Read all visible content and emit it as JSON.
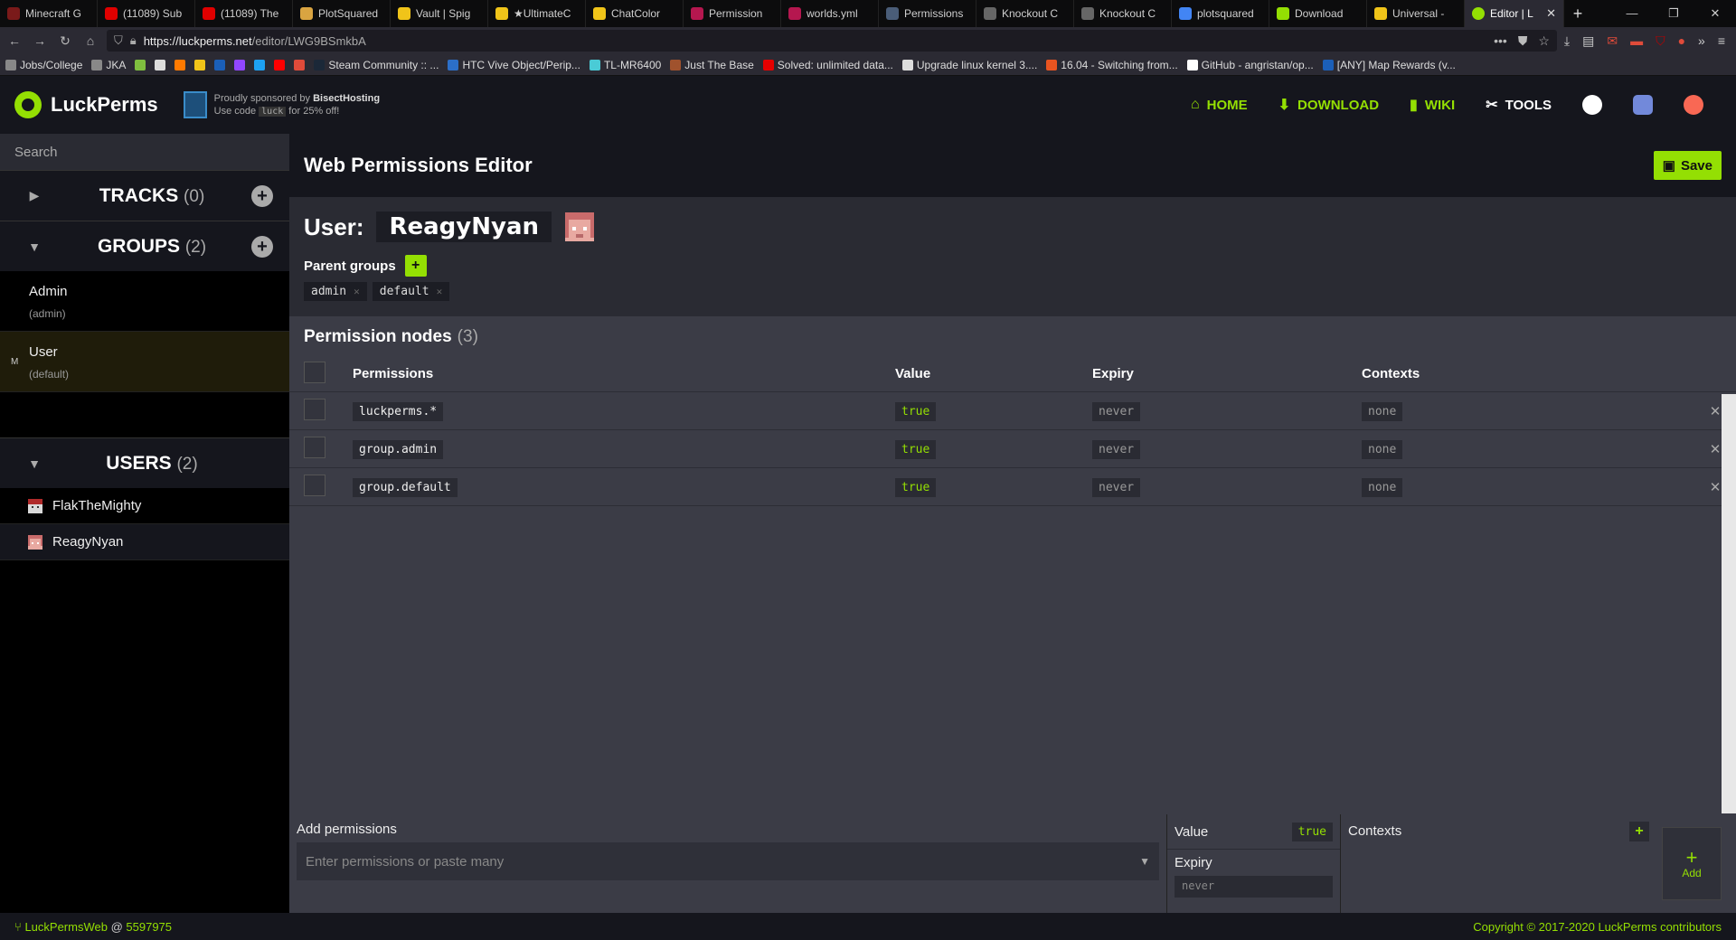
{
  "browser": {
    "tabs": [
      {
        "label": "Minecraft G",
        "color": "#7a1a1a"
      },
      {
        "label": "(11089) Sub",
        "color": "#e00000"
      },
      {
        "label": "(11089) The",
        "color": "#e00000"
      },
      {
        "label": "PlotSquared",
        "color": "#d9a441"
      },
      {
        "label": "Vault | Spig",
        "color": "#f0c419"
      },
      {
        "label": "★UltimateC",
        "color": "#f0c419"
      },
      {
        "label": "ChatColor",
        "color": "#f0c419"
      },
      {
        "label": "Permission",
        "color": "#b5174f"
      },
      {
        "label": "worlds.yml",
        "color": "#b5174f"
      },
      {
        "label": "Permissions",
        "color": "#4a5d78"
      },
      {
        "label": "Knockout C",
        "color": "#666666"
      },
      {
        "label": "Knockout C",
        "color": "#666666"
      },
      {
        "label": "plotsquared",
        "color": "#4285f4"
      },
      {
        "label": "Download",
        "color": "#94df03"
      },
      {
        "label": "Universal -",
        "color": "#f0c419"
      }
    ],
    "active_tab": "Editor | L",
    "url_host": "https://luckperms.net",
    "url_path": "/editor/LWG9BSmkbA",
    "bookmarks": [
      {
        "label": "Jobs/College",
        "color": "#888888"
      },
      {
        "label": "JKA",
        "color": "#888888"
      },
      {
        "label": "",
        "color": "#7fbf3f"
      },
      {
        "label": "",
        "color": "#dddddd"
      },
      {
        "label": "",
        "color": "#ff7a00"
      },
      {
        "label": "",
        "color": "#f0c419"
      },
      {
        "label": "",
        "color": "#1b5fb8"
      },
      {
        "label": "",
        "color": "#9146ff"
      },
      {
        "label": "",
        "color": "#1da1f2"
      },
      {
        "label": "",
        "color": "#ff0000"
      },
      {
        "label": "",
        "color": "#e04b3a"
      },
      {
        "label": "Steam Community :: ...",
        "color": "#1b2838"
      },
      {
        "label": "HTC Vive Object/Perip...",
        "color": "#2c6fc9"
      },
      {
        "label": "TL-MR6400",
        "color": "#4acbd6"
      },
      {
        "label": "Just The Base",
        "color": "#a0522d"
      },
      {
        "label": "Solved: unlimited data...",
        "color": "#e60000"
      },
      {
        "label": "Upgrade linux kernel 3....",
        "color": "#dddddd"
      },
      {
        "label": "16.04 - Switching from...",
        "color": "#e95420"
      },
      {
        "label": "GitHub - angristan/op...",
        "color": "#ffffff"
      },
      {
        "label": "[ANY] Map Rewards (v...",
        "color": "#1b5fb8"
      }
    ]
  },
  "app": {
    "logo": "LuckPerms",
    "sponsor_line1_prefix": "Proudly sponsored by ",
    "sponsor_name": "BisectHosting",
    "sponsor_line2_prefix": "Use code ",
    "sponsor_code": "luck",
    "sponsor_line2_suffix": " for 25% off!",
    "nav": {
      "home": "HOME",
      "download": "DOWNLOAD",
      "wiki": "WIKI",
      "tools": "TOOLS"
    },
    "accent": "#94df03"
  },
  "sidebar": {
    "search_placeholder": "Search",
    "tracks": {
      "title": "TRACKS",
      "count": "(0)"
    },
    "groups": {
      "title": "GROUPS",
      "count": "(2)",
      "items": [
        {
          "name": "Admin",
          "id": "(admin)"
        },
        {
          "name": "User",
          "id": "(default)",
          "mark": "M"
        }
      ]
    },
    "users": {
      "title": "USERS",
      "count": "(2)",
      "items": [
        {
          "name": "FlakTheMighty"
        },
        {
          "name": "ReagyNyan"
        }
      ]
    }
  },
  "editor": {
    "title": "Web Permissions Editor",
    "save_label": "Save",
    "user_label": "User:",
    "username": "ReagyNyan",
    "parent_groups_label": "Parent groups",
    "parent_groups": [
      "admin",
      "default"
    ],
    "nodes_title": "Permission nodes",
    "nodes_count": "(3)",
    "columns": {
      "permissions": "Permissions",
      "value": "Value",
      "expiry": "Expiry",
      "contexts": "Contexts"
    },
    "rows": [
      {
        "permission": "luckperms.*",
        "value": "true",
        "expiry": "never",
        "contexts": "none"
      },
      {
        "permission": "group.admin",
        "value": "true",
        "expiry": "never",
        "contexts": "none"
      },
      {
        "permission": "group.default",
        "value": "true",
        "expiry": "never",
        "contexts": "none"
      }
    ],
    "add": {
      "label": "Add permissions",
      "placeholder": "Enter permissions or paste many",
      "value_label": "Value",
      "value": "true",
      "expiry_label": "Expiry",
      "expiry": "never",
      "contexts_label": "Contexts",
      "add_label": "Add"
    }
  },
  "footer": {
    "left_name": "LuckPermsWeb",
    "left_at": "@",
    "left_commit": "5597975",
    "right": "Copyright © 2017-2020 LuckPerms contributors"
  }
}
